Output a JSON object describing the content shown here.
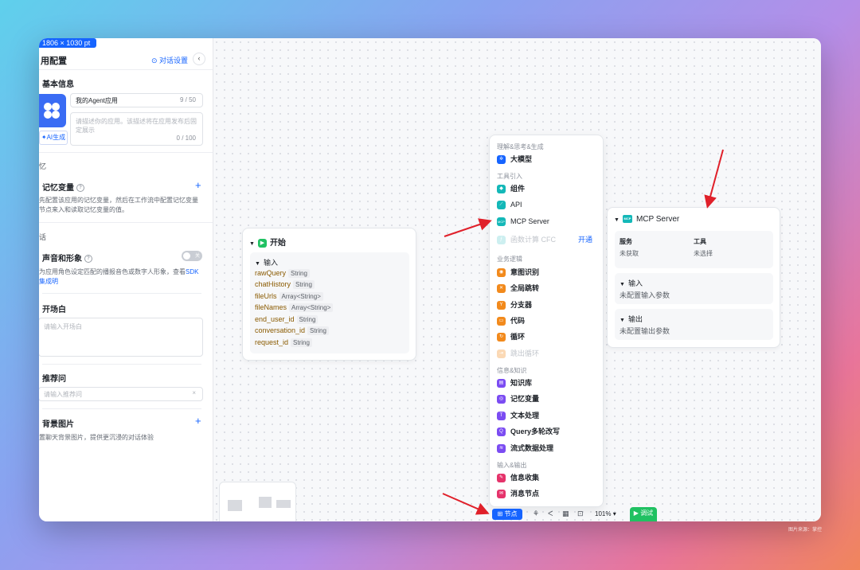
{
  "topbar": {
    "dimensions": "1806 × 1030 pt"
  },
  "sidebar": {
    "title": "用配置",
    "dialog_settings": "对话设置",
    "collapse": "‹",
    "basic_info": "基本信息",
    "app_name": "我的Agent应用",
    "app_name_count": "9 / 50",
    "app_desc_placeholder": "请描述你的应用。该描述将在应用发布后固定展示",
    "app_desc_count": "0 / 100",
    "ai_generate": "AI生成",
    "memory_section": "忆",
    "memory_variables": "记忆变量",
    "memory_desc": "先配置该应用的记忆变量，然后在工作流中配置记忆变量节点来入和读取记忆变量的值。",
    "dialog_section": "话",
    "voice_avatar": "声音和形象",
    "toggle_label": "关",
    "voice_desc_1": "为应用角色设定匹配的播报音色或数字人形象，查看",
    "voice_desc_link": "SDK集成",
    "voice_desc_2": "明",
    "opening": "开场白",
    "opening_placeholder": "请输入开场白",
    "suggested": "推荐问",
    "suggested_placeholder": "请输入推荐问",
    "clear": "×",
    "background": "背景图片",
    "background_desc": "置聊天背景图片，提供更沉浸的对话体验",
    "plus": "+",
    "help": "?"
  },
  "start_node": {
    "title": "开始",
    "input_label": "输入",
    "params": [
      {
        "name": "rawQuery",
        "type": "String"
      },
      {
        "name": "chatHistory",
        "type": "String"
      },
      {
        "name": "fileUrls",
        "type": "Array<String>"
      },
      {
        "name": "fileNames",
        "type": "Array<String>"
      },
      {
        "name": "end_user_id",
        "type": "String"
      },
      {
        "name": "conversation_id",
        "type": "String"
      },
      {
        "name": "request_id",
        "type": "String"
      }
    ]
  },
  "menu": {
    "sec1": "理解&思考&生成",
    "item_llm": "大模型",
    "sec2": "工具引入",
    "item_component": "组件",
    "item_api": "API",
    "item_mcp": "MCP Server",
    "item_cfc": "函数计算 CFC",
    "item_cfc_action": "开通",
    "sec3": "业务逻辑",
    "item_intent": "意图识别",
    "item_jump": "全局跳转",
    "item_branch": "分支器",
    "item_code": "代码",
    "item_loop": "循环",
    "item_break": "跳出循环",
    "sec4": "信息&知识",
    "item_kb": "知识库",
    "item_memvar": "记忆变量",
    "item_text": "文本处理",
    "item_query": "Query多轮改写",
    "item_stream": "流式数据处理",
    "sec5": "输入&输出",
    "item_collect": "信息收集",
    "item_message": "消息节点",
    "mcp_badge": "MCP"
  },
  "mcp_node": {
    "title": "MCP Server",
    "service_label": "服务",
    "service_value": "未获取",
    "tool_label": "工具",
    "tool_value": "未选择",
    "input_label": "输入",
    "input_empty": "未配置输入参数",
    "output_label": "输出",
    "output_empty": "未配置输出参数"
  },
  "toolbar": {
    "node_button": "节点",
    "zoom": "101%",
    "run": "调试"
  },
  "watermark": "图片来源：掌控",
  "colors": {
    "accent": "#1664ff",
    "start_green": "#20c162",
    "mcp_teal": "#14b8b8",
    "arrow_red": "#e0202a"
  }
}
